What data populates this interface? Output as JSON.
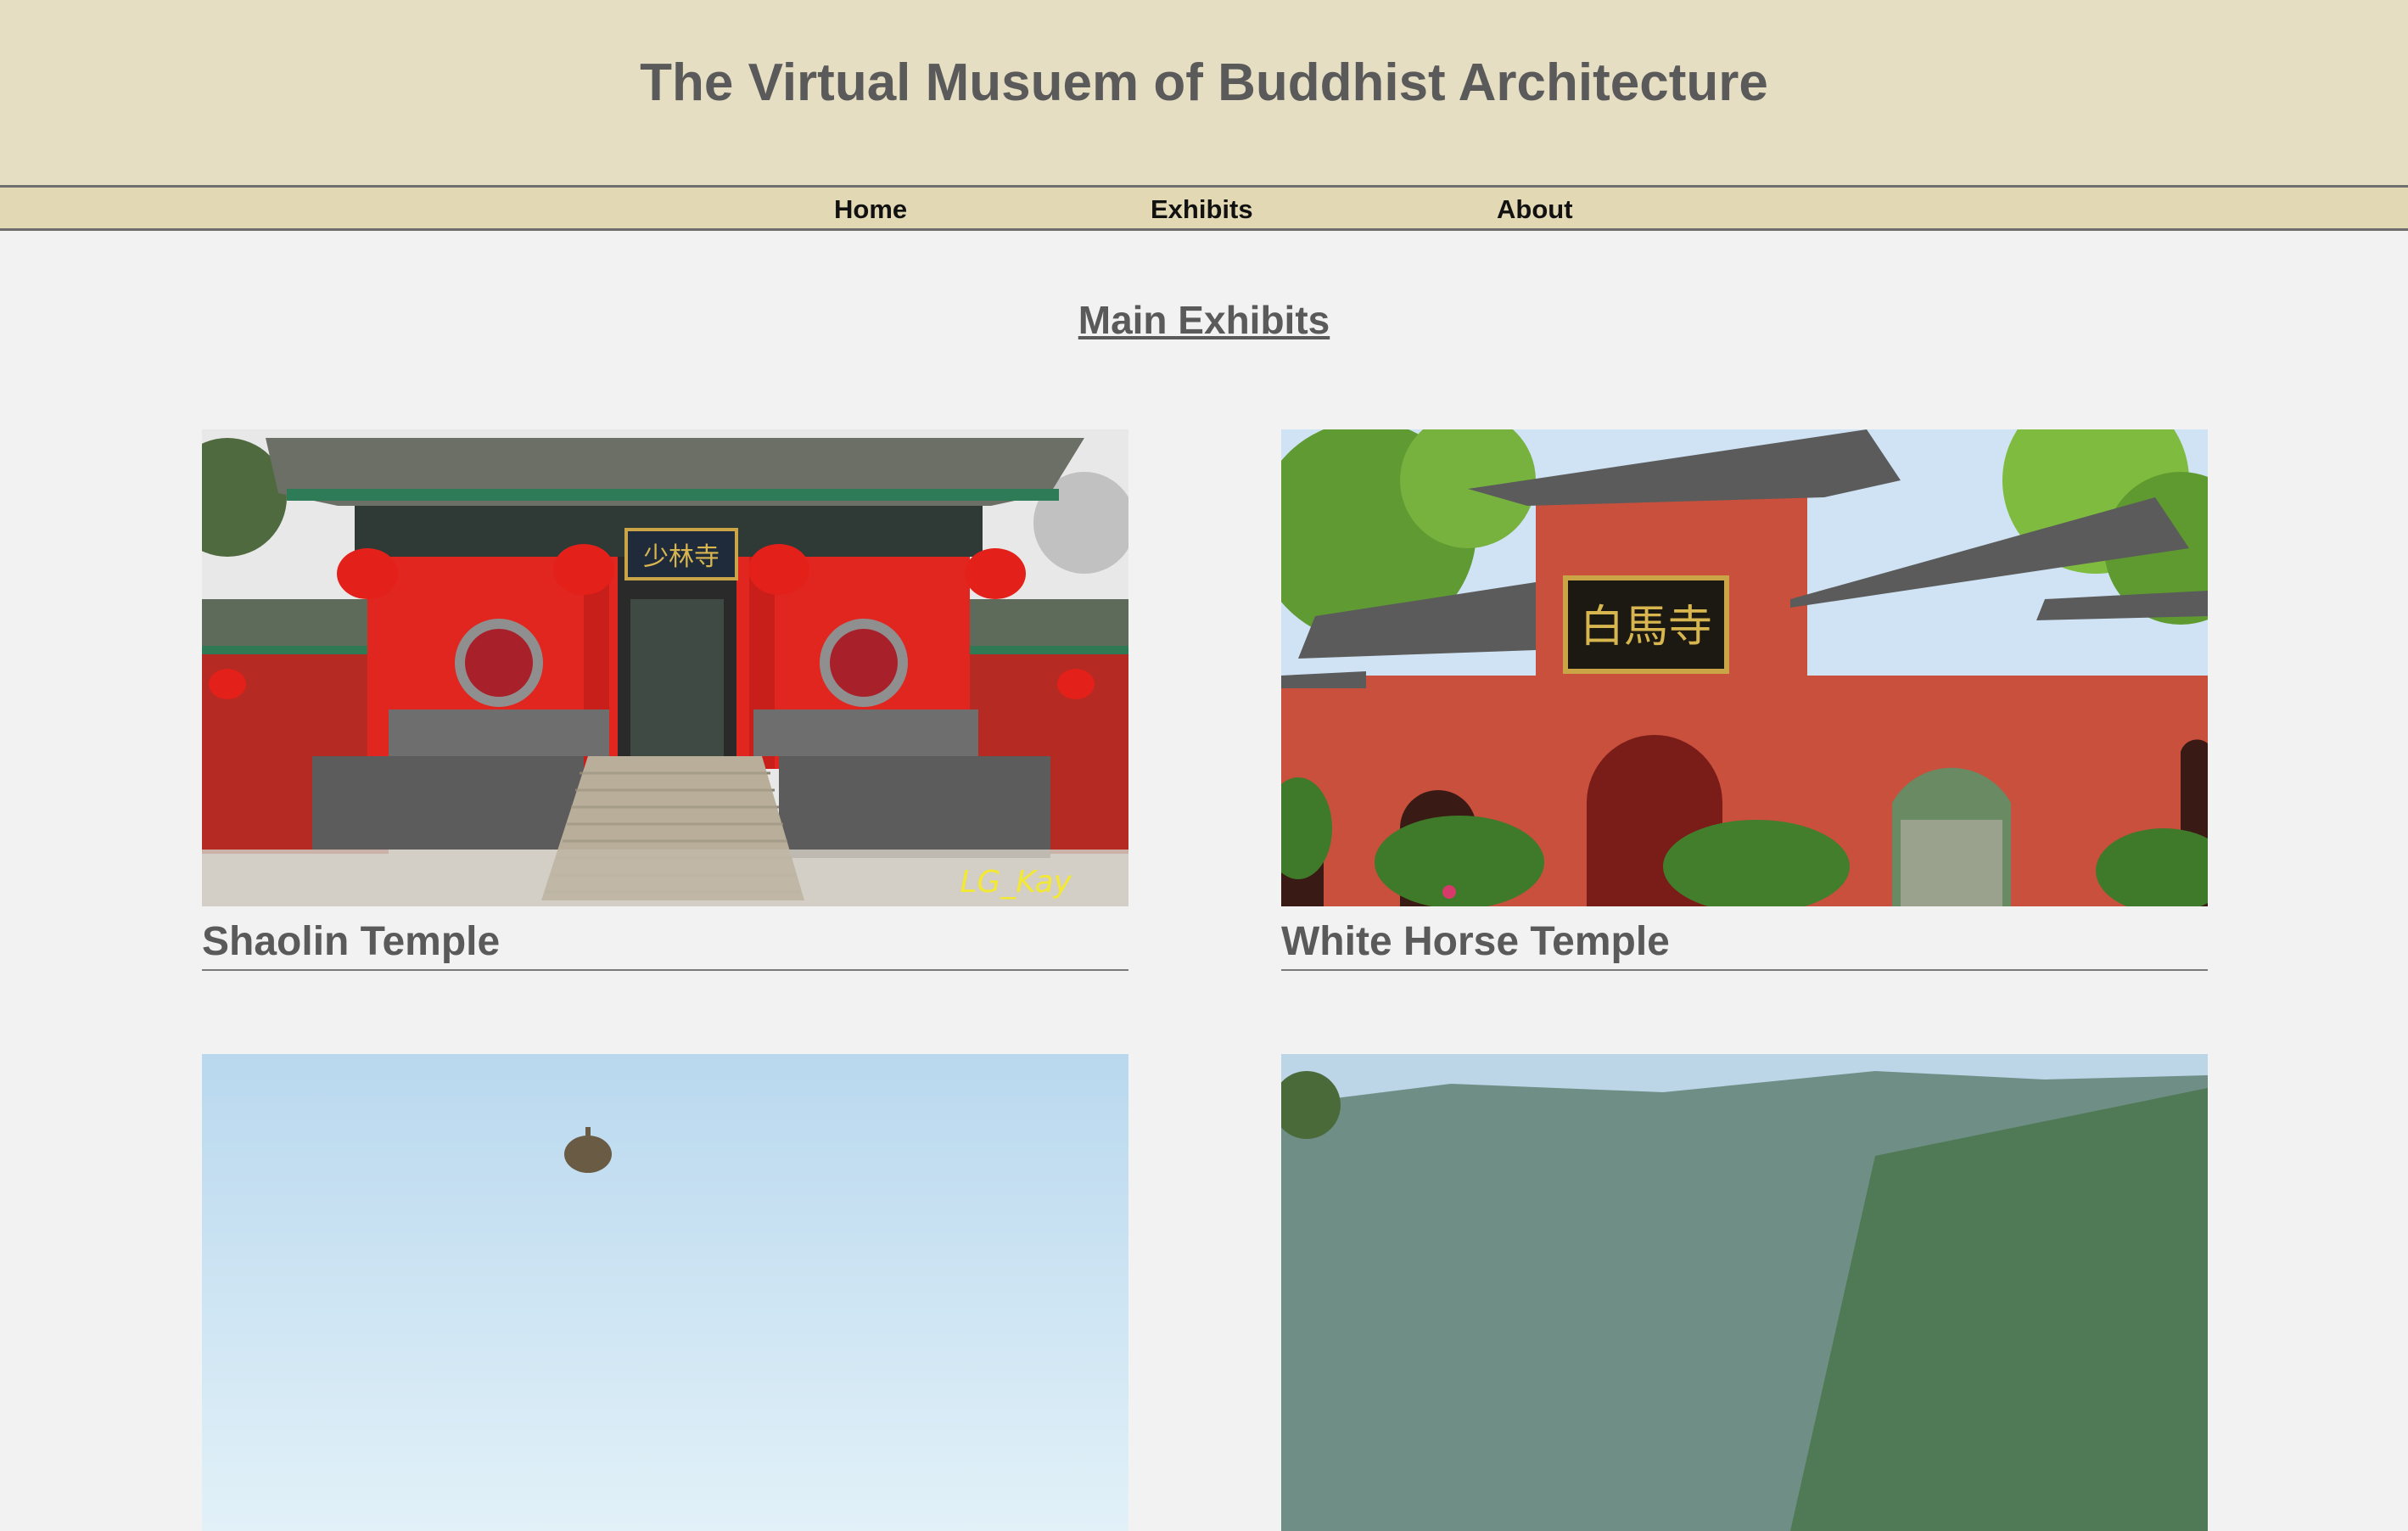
{
  "header": {
    "title": "The Virtual Musuem of Buddhist Architecture"
  },
  "nav": {
    "home": "Home",
    "exhibits": "Exhibits",
    "about": "About"
  },
  "main": {
    "heading": "Main Exhibits",
    "exhibits": [
      {
        "title": "Shaolin Temple",
        "watermark": "LG_Kay",
        "plaque": "少林寺"
      },
      {
        "title": "White Horse Temple",
        "plaque": "白馬寺"
      },
      {
        "title": ""
      },
      {
        "title": ""
      }
    ]
  },
  "colors": {
    "header_bg": "#e6dec3",
    "nav_bg": "#e2d8b4",
    "page_bg": "#f2f2f2",
    "title_text": "#5a5a5a"
  }
}
